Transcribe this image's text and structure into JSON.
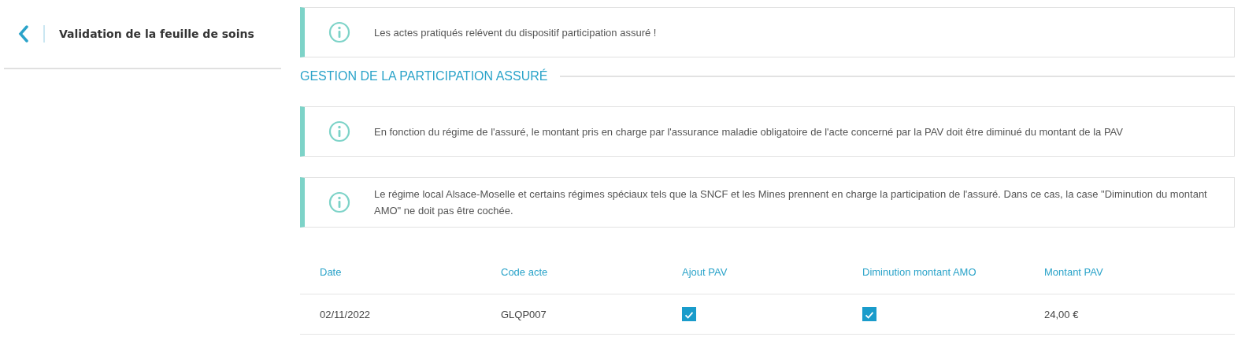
{
  "sidebar": {
    "title": "Validation de la feuille de soins"
  },
  "notice": {
    "text": "Les actes pratiqués relévent du dispositif participation assuré !"
  },
  "section": {
    "title": "GESTION DE LA PARTICIPATION ASSURÉ",
    "notices": [
      {
        "text": "En fonction du régime de l'assuré, le montant pris en charge par l'assurance maladie obligatoire de l'acte concerné par la PAV doit être diminué du montant de la PAV"
      },
      {
        "text": "Le régime local Alsace-Moselle et certains régimes spéciaux tels que la SNCF et les Mines prennent en charge la participation de l'assuré. Dans ce cas, la case \"Diminution du montant AMO\" ne doit pas être cochée."
      }
    ]
  },
  "table": {
    "columns": [
      "Date",
      "Code acte",
      "Ajout PAV",
      "Diminution montant AMO",
      "Montant PAV"
    ],
    "rows": [
      {
        "date": "02/11/2022",
        "code": "GLQP007",
        "ajout_pav": true,
        "diminution_amo": true,
        "montant": "24,00 €"
      }
    ]
  }
}
